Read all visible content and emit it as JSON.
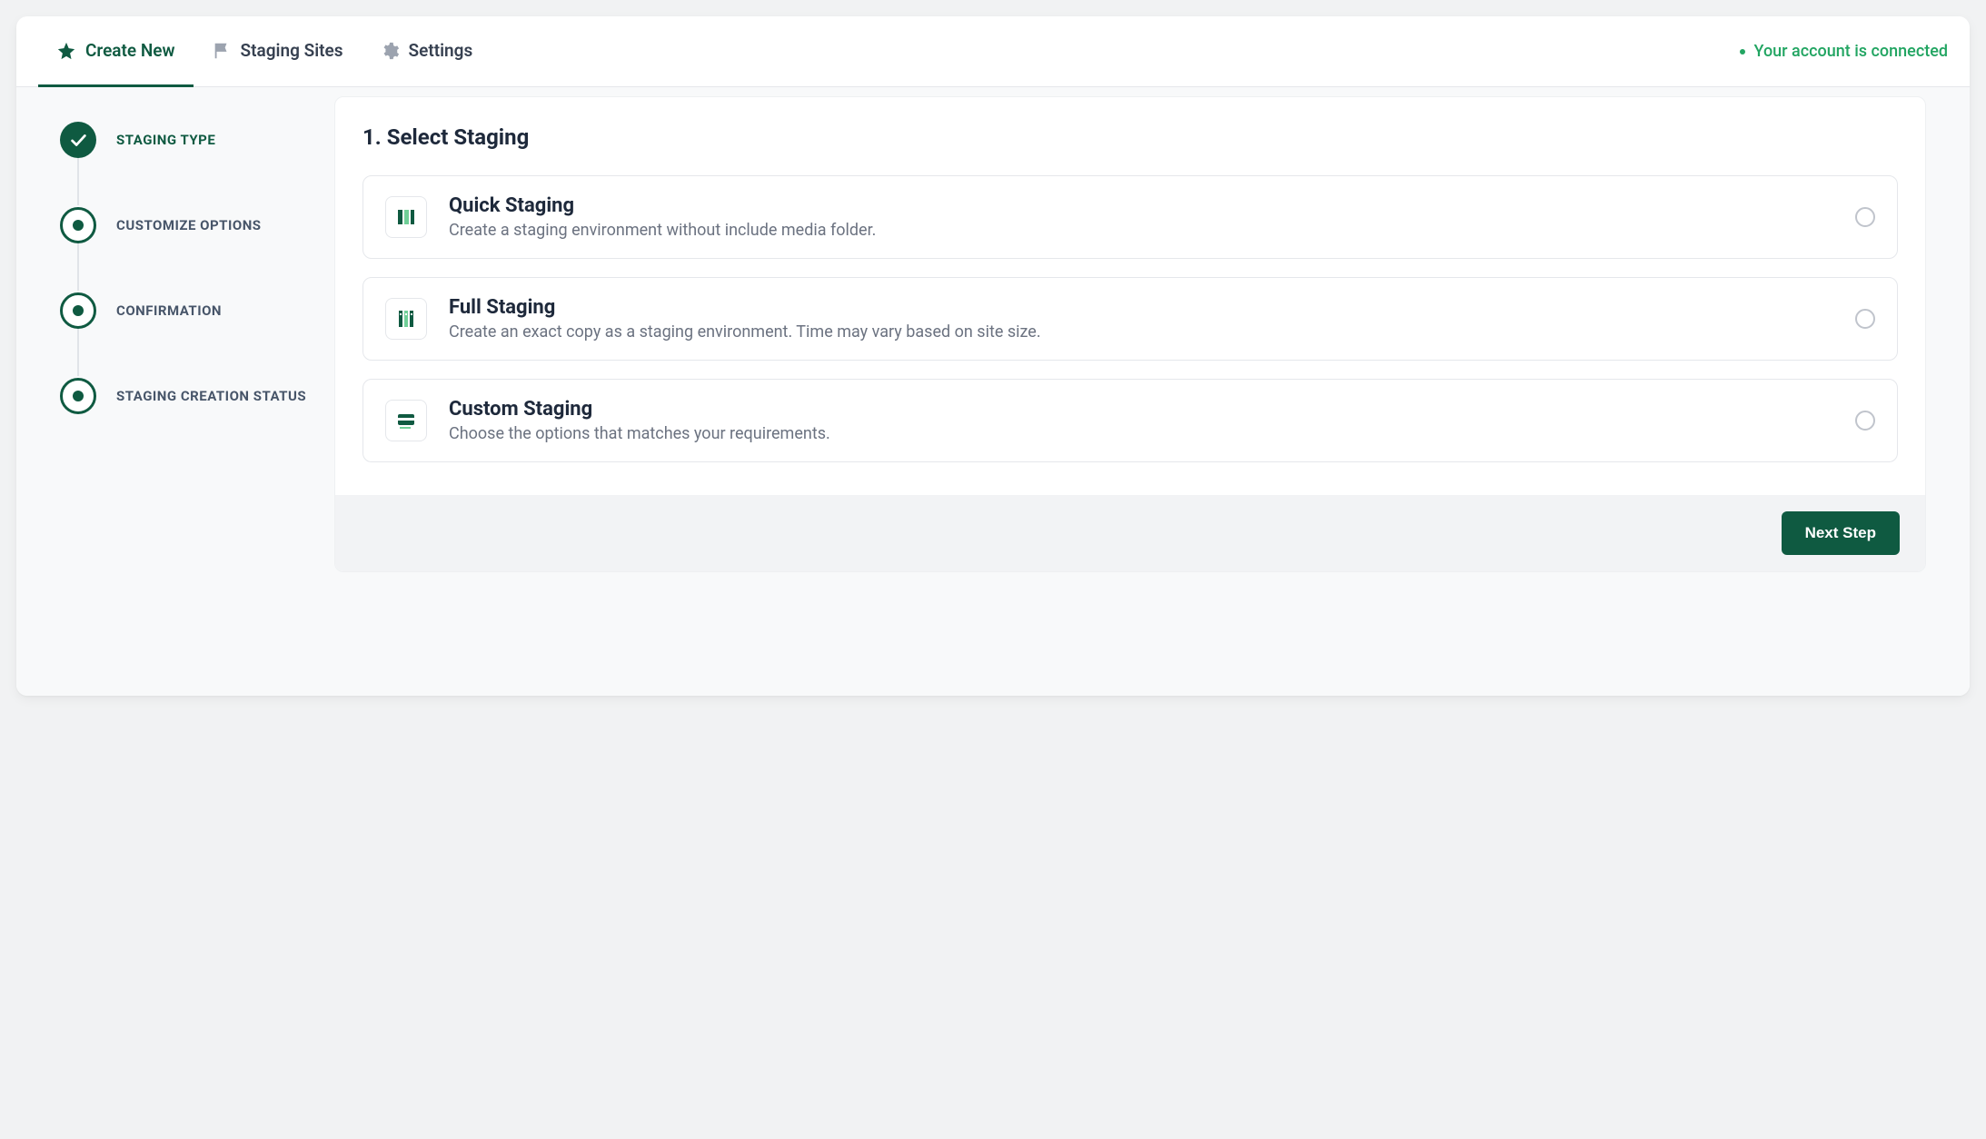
{
  "tabs": {
    "create_new": "Create New",
    "staging_sites": "Staging Sites",
    "settings": "Settings"
  },
  "account_status": "Your account is connected",
  "steps": [
    {
      "label": "STAGING TYPE",
      "state": "done"
    },
    {
      "label": "CUSTOMIZE OPTIONS",
      "state": "pending"
    },
    {
      "label": "CONFIRMATION",
      "state": "pending"
    },
    {
      "label": "STAGING CREATION STATUS",
      "state": "pending"
    }
  ],
  "panel": {
    "title": "1. Select Staging",
    "options": [
      {
        "title": "Quick Staging",
        "desc": "Create a staging environment without include media folder."
      },
      {
        "title": "Full Staging",
        "desc": "Create an exact copy as a staging environment. Time may vary based on site size."
      },
      {
        "title": "Custom Staging",
        "desc": "Choose the options that matches your requirements."
      }
    ]
  },
  "actions": {
    "next": "Next Step"
  }
}
